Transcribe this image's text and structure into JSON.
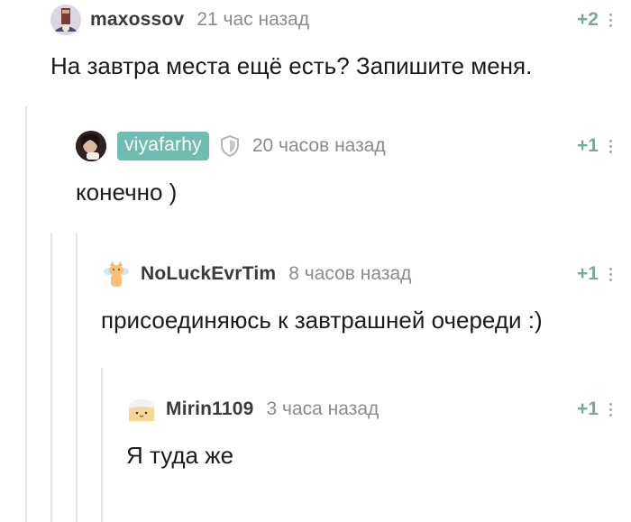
{
  "comments": [
    {
      "username": "maxossov",
      "time": "21 час назад",
      "rating": "+2",
      "text": "На завтра места ещё есть? Запишите меня.",
      "avatar_icon": "user-photo-avatar"
    },
    {
      "username": "viyafarhy",
      "time": "20 часов назад",
      "rating": "+1",
      "text": "конечно )",
      "avatar_icon": "user-photo-avatar",
      "badge_icon": "shield-icon",
      "username_bg": "#6fbdb1"
    },
    {
      "username": "NoLuckEvrTim",
      "time": "8 часов назад",
      "rating": "+1",
      "text": "присоединяюсь к завтрашней очереди :)",
      "avatar_icon": "cat-angel-avatar"
    },
    {
      "username": "Mirin1109",
      "time": "3 часа назад",
      "rating": "+1",
      "text": "Я туда же",
      "avatar_icon": "bread-character-avatar"
    }
  ],
  "colors": {
    "rating": "#7aa8a0",
    "time": "#8b8b8b",
    "thread_line": "#e6e6e6"
  }
}
